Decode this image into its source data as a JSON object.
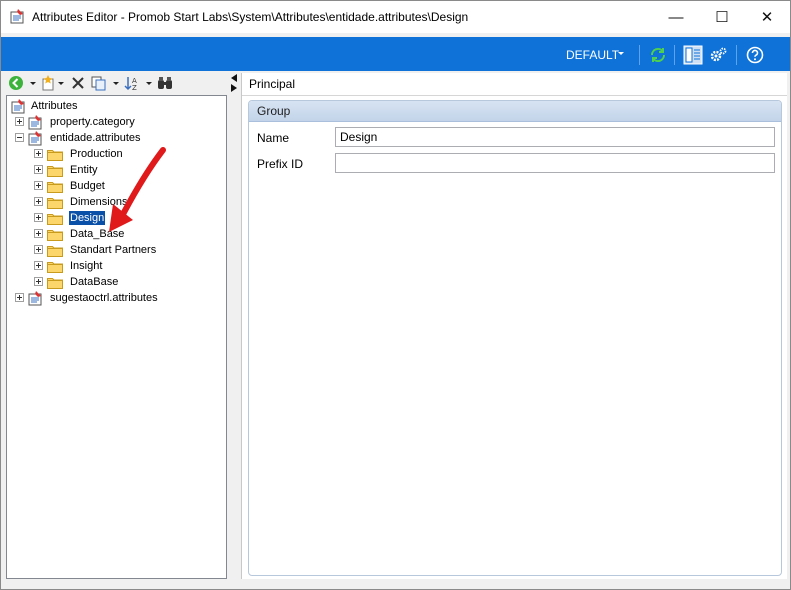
{
  "window": {
    "title": "Attributes Editor - Promob Start Labs\\System\\Attributes\\entidade.attributes\\Design",
    "minimize_glyph": "—",
    "maximize_glyph": "☐",
    "close_glyph": "✕"
  },
  "ribbon": {
    "preset_label": "DEFAULT",
    "icons": [
      "refresh-icon",
      "layout-icon",
      "settings-icon",
      "help-icon"
    ],
    "accent_color": "#0e72d8"
  },
  "toolbar": {
    "icons": [
      "add-icon",
      "new-item-icon",
      "delete-icon",
      "copy-icon",
      "sort-icon",
      "find-icon"
    ]
  },
  "tree": {
    "root": "Attributes",
    "items": [
      {
        "label": "property.category",
        "level": 1,
        "expanded": false
      },
      {
        "label": "entidade.attributes",
        "level": 1,
        "expanded": true
      },
      {
        "label": "Production",
        "level": 2
      },
      {
        "label": "Entity",
        "level": 2
      },
      {
        "label": "Budget",
        "level": 2
      },
      {
        "label": "Dimensions",
        "level": 2
      },
      {
        "label": "Design",
        "level": 2,
        "selected": true
      },
      {
        "label": "Data_Base",
        "level": 2
      },
      {
        "label": "Standart Partners",
        "level": 2
      },
      {
        "label": "Insight",
        "level": 2
      },
      {
        "label": "DataBase",
        "level": 2
      },
      {
        "label": "sugestaoctrl.attributes",
        "level": 1,
        "expanded": false
      }
    ]
  },
  "panel": {
    "tab": "Principal",
    "group_title": "Group",
    "fields": [
      {
        "label": "Name",
        "value": "Design"
      },
      {
        "label": "Prefix ID",
        "value": ""
      }
    ]
  }
}
